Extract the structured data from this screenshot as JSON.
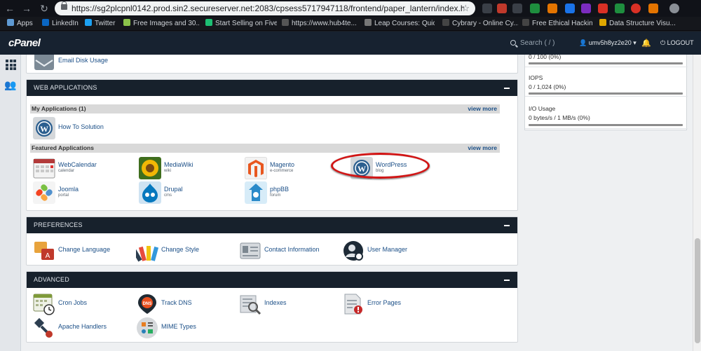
{
  "browser": {
    "url": "https://sg2plcpnl0142.prod.sin2.secureserver.net:2083/cpsess5717947118/frontend/paper_lantern/index.ht...",
    "bookmarks": [
      "Apps",
      "LinkedIn",
      "Twitter",
      "Free Images and 30...",
      "Start Selling on Fiverr",
      "https://www.hub4te...",
      "Leap Courses: Quic...",
      "Cybrary - Online Cy...",
      "Free Ethical Hacking...",
      "Data Structure Visu..."
    ]
  },
  "cpanel": {
    "logo": "cPanel",
    "search_placeholder": "Search ( / )",
    "username": "umv5h8yz2e20",
    "logout": "LOGOUT"
  },
  "top_item": {
    "label": "Email Disk Usage"
  },
  "web_applications": {
    "title": "WEB APPLICATIONS",
    "my_apps_label": "My Applications (1)",
    "featured_label": "Featured Applications",
    "view_more": "view more",
    "my_apps": [
      {
        "label": "How To Solution"
      }
    ],
    "featured": [
      {
        "label": "WebCalendar",
        "sub": "calendar"
      },
      {
        "label": "MediaWiki",
        "sub": "wiki"
      },
      {
        "label": "Magento",
        "sub": "e-commerce"
      },
      {
        "label": "WordPress",
        "sub": "blog"
      },
      {
        "label": "Joomla",
        "sub": "portal"
      },
      {
        "label": "Drupal",
        "sub": "cms"
      },
      {
        "label": "phpBB",
        "sub": "forum"
      }
    ]
  },
  "preferences": {
    "title": "PREFERENCES",
    "items": [
      "Change Language",
      "Change Style",
      "Contact Information",
      "User Manager"
    ]
  },
  "advanced": {
    "title": "ADVANCED",
    "items": [
      "Cron Jobs",
      "Track DNS",
      "Indexes",
      "Error Pages",
      "Apache Handlers",
      "MIME Types"
    ]
  },
  "stats": [
    {
      "title": "",
      "value": "0 / 100   (0%)",
      "percent": 0
    },
    {
      "title": "IOPS",
      "value": "0 / 1,024   (0%)",
      "percent": 0
    },
    {
      "title": "I/O Usage",
      "value": "0 bytes/s / 1 MB/s   (0%)",
      "percent": 0
    }
  ],
  "colors": {
    "header": "#172230",
    "panel_head": "#17212c",
    "link": "#1b4f87",
    "highlight": "#d21414"
  }
}
